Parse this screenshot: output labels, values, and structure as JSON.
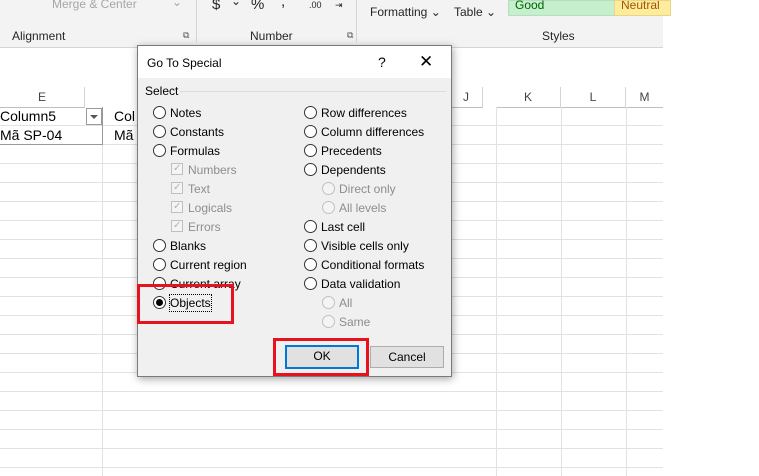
{
  "ribbon": {
    "merge_center": "Merge & Center",
    "currency_symbol": "$",
    "percent_symbol": "%",
    "comma_symbol": ",",
    "formatting": "Formatting",
    "table": "Table",
    "style_good": "Good",
    "style_neutral": "Neutral",
    "group_alignment": "Alignment",
    "group_number": "Number",
    "group_styles": "Styles",
    "decrease_decimal": ".00"
  },
  "sheet": {
    "columns": [
      "E",
      "J",
      "K",
      "L",
      "M"
    ],
    "header_cell": "Column5",
    "header_cell_next": "Col",
    "value_cell": "Mã SP-04",
    "value_cell_next": "Mã"
  },
  "dialog": {
    "title": "Go To Special",
    "help": "?",
    "close": "✕",
    "group_label": "Select",
    "left_options": [
      {
        "label": "Notes"
      },
      {
        "label": "Constants"
      },
      {
        "label": "Formulas"
      },
      {
        "label": "Numbers"
      },
      {
        "label": "Text"
      },
      {
        "label": "Logicals"
      },
      {
        "label": "Errors"
      },
      {
        "label": "Blanks"
      },
      {
        "label": "Current region"
      },
      {
        "label": "Current array"
      },
      {
        "label": "Objects"
      }
    ],
    "right_options": [
      {
        "label": "Row differences"
      },
      {
        "label": "Column differences"
      },
      {
        "label": "Precedents"
      },
      {
        "label": "Dependents"
      },
      {
        "label": "Direct only"
      },
      {
        "label": "All levels"
      },
      {
        "label": "Last cell"
      },
      {
        "label": "Visible cells only"
      },
      {
        "label": "Conditional formats"
      },
      {
        "label": "Data validation"
      },
      {
        "label": "All"
      },
      {
        "label": "Same"
      }
    ],
    "selected_option": "Objects",
    "ok_label": "OK",
    "cancel_label": "Cancel"
  },
  "colors": {
    "highlight": "#e8121e",
    "default_button_border": "#0078d7"
  }
}
